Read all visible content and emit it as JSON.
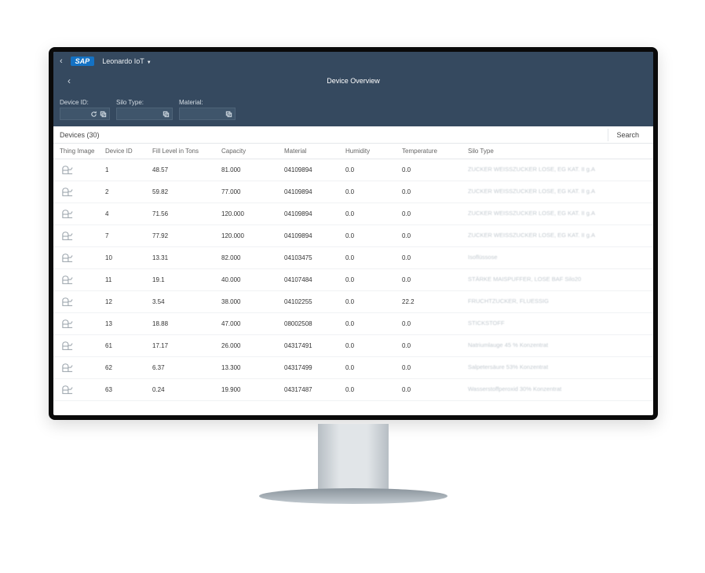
{
  "shell": {
    "product": "Leonardo IoT",
    "logo": "SAP"
  },
  "page": {
    "title": "Device Overview"
  },
  "filters": {
    "deviceId": {
      "label": "Device ID:"
    },
    "siloType": {
      "label": "Silo Type:"
    },
    "material": {
      "label": "Material:"
    }
  },
  "section": {
    "title": "Devices (30)",
    "searchLabel": "Search"
  },
  "columns": {
    "thingImage": "Thing Image",
    "deviceId": "Device ID",
    "fillLevel": "Fill Level in Tons",
    "capacity": "Capacity",
    "material": "Material",
    "humidity": "Humidity",
    "temperature": "Temperature",
    "siloType": "Silo Type"
  },
  "rows": [
    {
      "deviceId": "1",
      "fillLevel": "48.57",
      "capacity": "81.000",
      "material": "04109894",
      "humidity": "0.0",
      "temperature": "0.0",
      "siloType": "ZUCKER WEISSZUCKER LOSE, EG KAT. II g.A"
    },
    {
      "deviceId": "2",
      "fillLevel": "59.82",
      "capacity": "77.000",
      "material": "04109894",
      "humidity": "0.0",
      "temperature": "0.0",
      "siloType": "ZUCKER WEISSZUCKER LOSE, EG KAT. II g.A"
    },
    {
      "deviceId": "4",
      "fillLevel": "71.56",
      "capacity": "120.000",
      "material": "04109894",
      "humidity": "0.0",
      "temperature": "0.0",
      "siloType": "ZUCKER WEISSZUCKER LOSE, EG KAT. II g.A"
    },
    {
      "deviceId": "7",
      "fillLevel": "77.92",
      "capacity": "120.000",
      "material": "04109894",
      "humidity": "0.0",
      "temperature": "0.0",
      "siloType": "ZUCKER WEISSZUCKER LOSE, EG KAT. II g.A"
    },
    {
      "deviceId": "10",
      "fillLevel": "13.31",
      "capacity": "82.000",
      "material": "04103475",
      "humidity": "0.0",
      "temperature": "0.0",
      "siloType": "Isoflüssose"
    },
    {
      "deviceId": "11",
      "fillLevel": "19.1",
      "capacity": "40.000",
      "material": "04107484",
      "humidity": "0.0",
      "temperature": "0.0",
      "siloType": "STÄRKE MAISPUFFER, LOSE BAF Silo20"
    },
    {
      "deviceId": "12",
      "fillLevel": "3.54",
      "capacity": "38.000",
      "material": "04102255",
      "humidity": "0.0",
      "temperature": "22.2",
      "siloType": "FRUCHTZUCKER, FLUESSIG"
    },
    {
      "deviceId": "13",
      "fillLevel": "18.88",
      "capacity": "47.000",
      "material": "08002508",
      "humidity": "0.0",
      "temperature": "0.0",
      "siloType": "STICKSTOFF"
    },
    {
      "deviceId": "61",
      "fillLevel": "17.17",
      "capacity": "26.000",
      "material": "04317491",
      "humidity": "0.0",
      "temperature": "0.0",
      "siloType": "Natriumlauge 45 % Konzentrat"
    },
    {
      "deviceId": "62",
      "fillLevel": "6.37",
      "capacity": "13.300",
      "material": "04317499",
      "humidity": "0.0",
      "temperature": "0.0",
      "siloType": "Salpetersäure 53% Konzentrat"
    },
    {
      "deviceId": "63",
      "fillLevel": "0.24",
      "capacity": "19.900",
      "material": "04317487",
      "humidity": "0.0",
      "temperature": "0.0",
      "siloType": "Wasserstoffperoxid 30% Konzentrat"
    }
  ]
}
